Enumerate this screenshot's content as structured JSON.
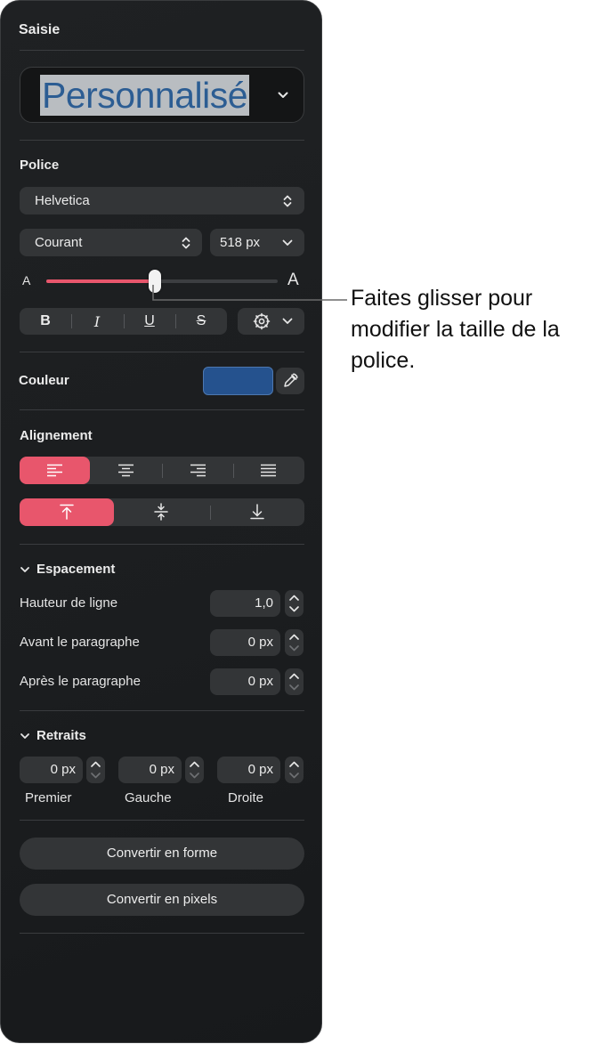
{
  "panel": {
    "title": "Saisie",
    "preview_text": "Personnalisé",
    "font": {
      "heading": "Police",
      "family": "Helvetica",
      "style": "Courant",
      "size": "518 px",
      "size_small_label": "A",
      "size_large_label": "A",
      "size_slider_fraction": 0.47,
      "bold": "B",
      "italic": "I",
      "underline": "U",
      "strike": "S"
    },
    "color": {
      "label": "Couleur",
      "swatch": "#25528e"
    },
    "alignment": {
      "heading": "Alignement"
    },
    "spacing": {
      "heading": "Espacement",
      "line_height_label": "Hauteur de ligne",
      "line_height_value": "1,0",
      "before_label": "Avant le paragraphe",
      "before_value": "0 px",
      "after_label": "Après le paragraphe",
      "after_value": "0 px"
    },
    "indents": {
      "heading": "Retraits",
      "first_value": "0 px",
      "left_value": "0 px",
      "right_value": "0 px",
      "first_label": "Premier",
      "left_label": "Gauche",
      "right_label": "Droite"
    },
    "convert_shape": "Convertir en forme",
    "convert_pixels": "Convertir en pixels"
  },
  "callout": "Faites glisser pour modifier la taille de la police.",
  "colors": {
    "accent": "#e8566c",
    "panel_bg": "#1e2022",
    "control_bg": "#333537"
  }
}
